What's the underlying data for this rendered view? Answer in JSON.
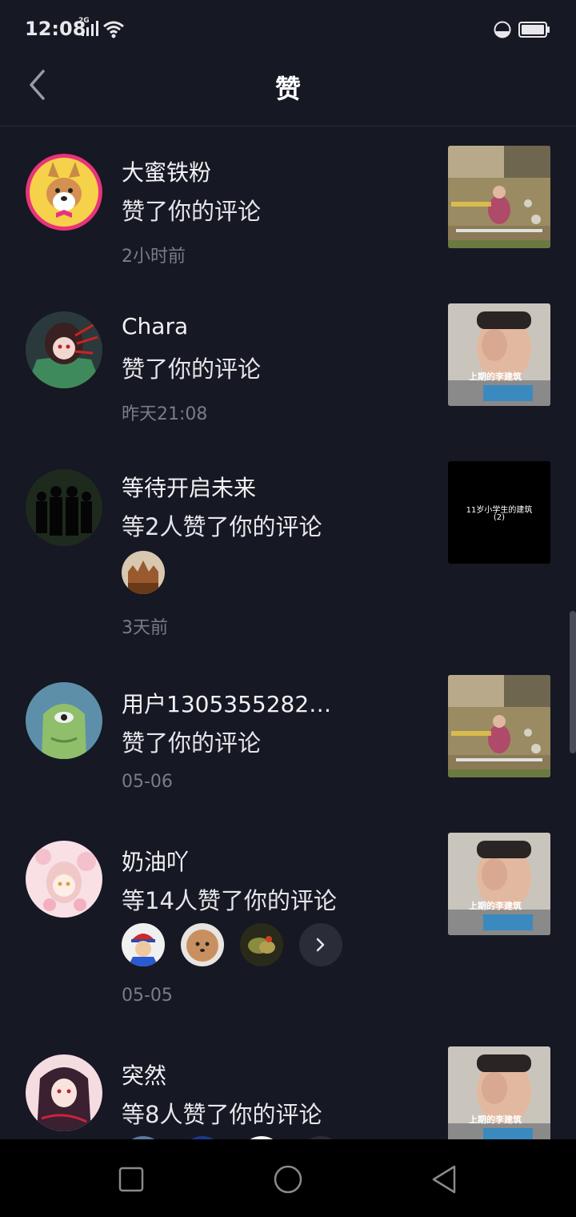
{
  "status": {
    "time": "12:08",
    "network": "2G"
  },
  "header": {
    "title": "赞"
  },
  "items": [
    {
      "name": "大蜜铁粉",
      "action": "赞了你的评论",
      "time": "2小时前"
    },
    {
      "name": "Chara",
      "action": "赞了你的评论",
      "time": "昨天21:08"
    },
    {
      "name": "等待开启未来",
      "action": "等2人赞了你的评论",
      "time": "3天前",
      "thumb_caption": "11岁小学生的建筑",
      "thumb_caption2": "(2)"
    },
    {
      "name": "用户13053552824...",
      "action": "赞了你的评论",
      "time": "05-06"
    },
    {
      "name": "奶油吖",
      "action": "等14人赞了你的评论",
      "time": "05-05"
    },
    {
      "name": "突然",
      "action": "等8人赞了你的评论",
      "time": ""
    }
  ],
  "thumb_text": {
    "video_caption": "上期的李建筑"
  },
  "colors": {
    "background": "#161823",
    "secondary_text": "#7a7c86",
    "divider": "#2a2c37"
  }
}
